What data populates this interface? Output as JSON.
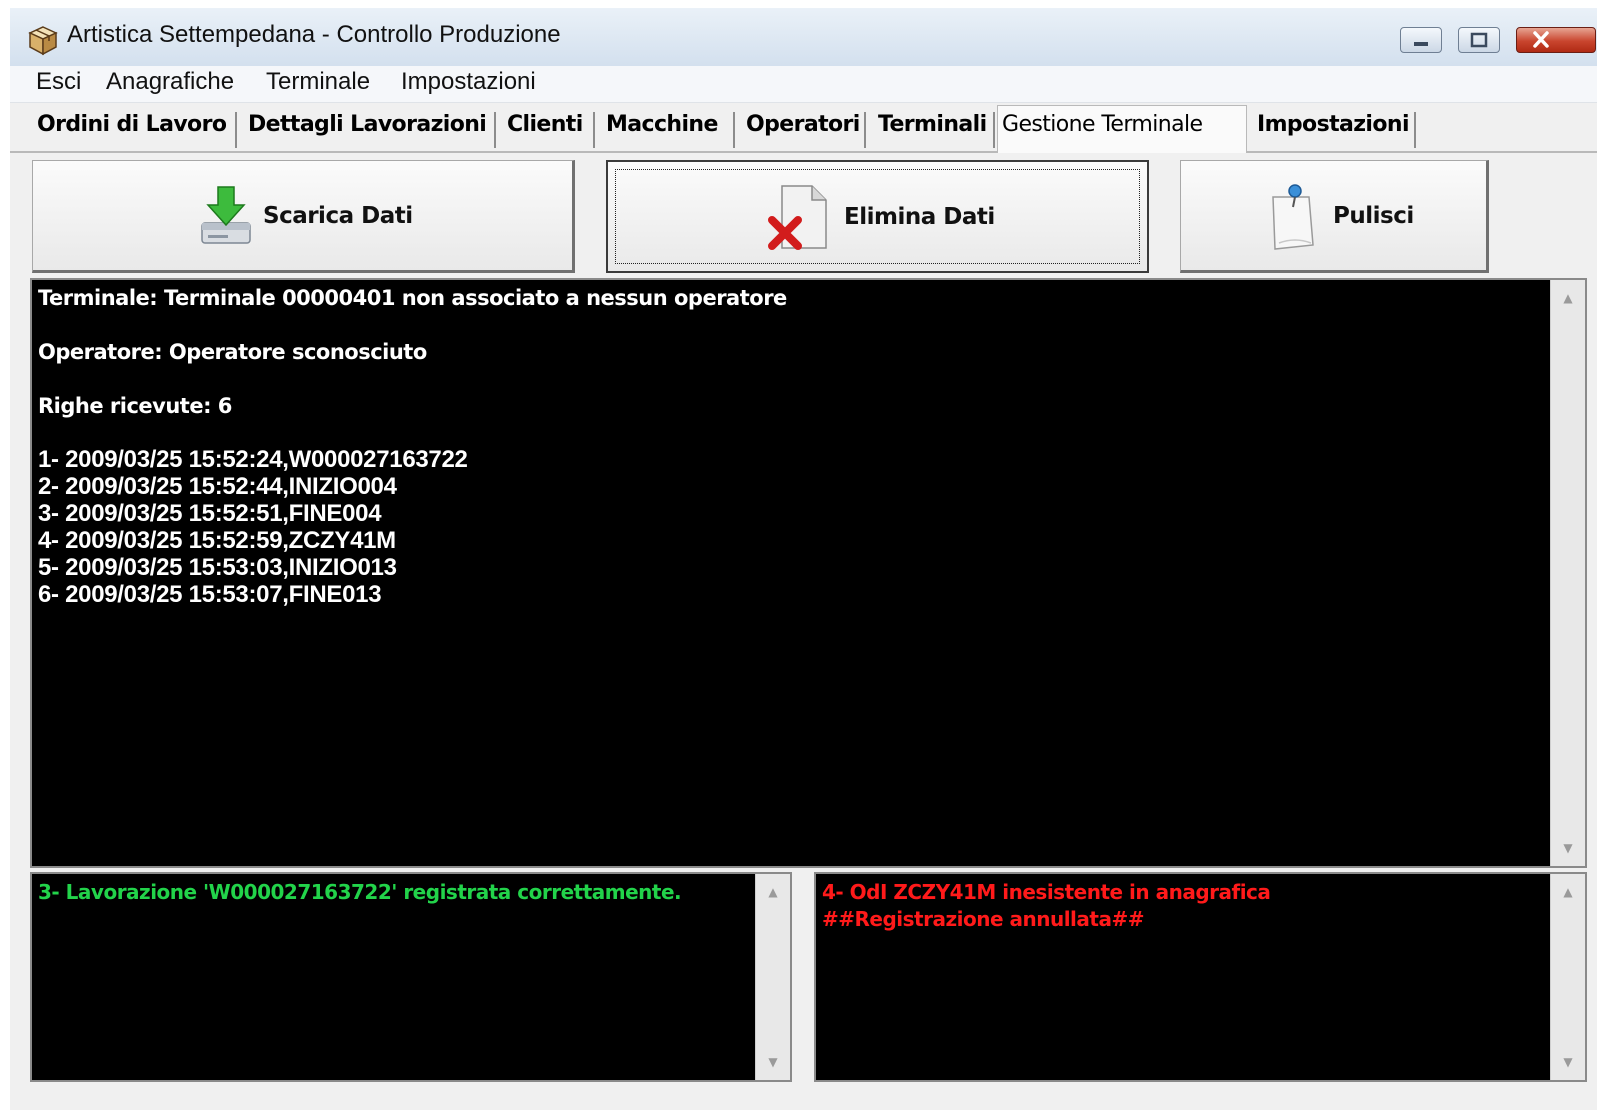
{
  "window": {
    "title": "Artistica Settempedana - Controllo Produzione",
    "icon": "box-icon",
    "controls": [
      "minimize-icon",
      "maximize-icon",
      "close-icon"
    ]
  },
  "menu": {
    "items": [
      "Esci",
      "Anagrafiche",
      "Terminale",
      "Impostazioni"
    ]
  },
  "tabs": {
    "items": [
      "Ordini di Lavoro",
      "Dettagli Lavorazioni",
      "Clienti",
      "Macchine",
      "Operatori",
      "Terminali",
      "Gestione Terminale",
      "Impostazioni"
    ],
    "active": "Gestione Terminale"
  },
  "toolbar": {
    "scarica_label": "Scarica Dati",
    "scarica_icon": "download-drive-icon",
    "elimina_label": "Elimina Dati",
    "elimina_icon": "delete-document-icon",
    "pulisci_label": "Pulisci",
    "pulisci_icon": "clear-note-icon"
  },
  "log": {
    "terminal": "Terminale: Terminale 00000401 non associato a nessun operatore",
    "operator": "Operatore: Operatore sconosciuto",
    "rows_received": "Righe ricevute: 6",
    "entries": [
      "1-  2009/03/25 15:52:24,W000027163722",
      "2-  2009/03/25 15:52:44,INIZIO004",
      "3-  2009/03/25 15:52:51,FINE004",
      "4-  2009/03/25 15:52:59,ZCZY41M",
      "5-  2009/03/25 15:53:03,INIZIO013",
      "6-  2009/03/25 15:53:07,FINE013"
    ]
  },
  "success_log": {
    "line1": "3- Lavorazione 'W000027163722' registrata correttamente."
  },
  "error_log": {
    "line1": "4- OdI ZCZY41M inesistente in anagrafica",
    "line2": " ##Registrazione annullata##"
  },
  "colors": {
    "log_background": "#000000",
    "log_text": "#ffffff",
    "success_text": "#22d34a",
    "error_text": "#ff1a1a"
  }
}
